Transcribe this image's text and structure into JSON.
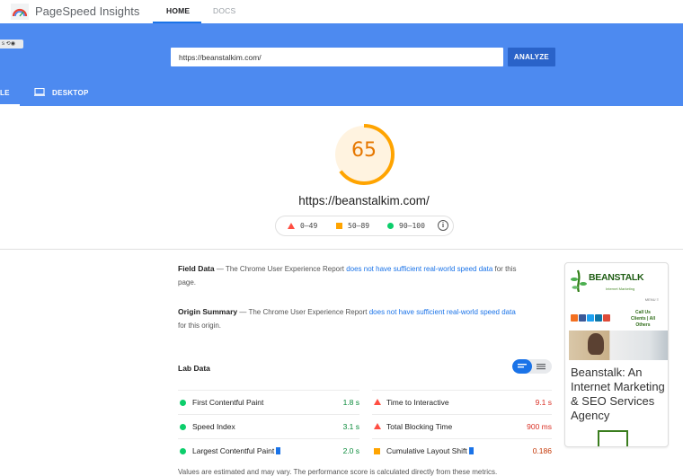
{
  "header": {
    "brand": "PageSpeed Insights",
    "nav": [
      {
        "label": "HOME"
      },
      {
        "label": "DOCS"
      }
    ]
  },
  "hero": {
    "extension_chip": "s",
    "url_value": "https://beanstalkim.com/",
    "analyze_label": "ANALYZE",
    "modes": [
      {
        "label": "LE",
        "active": true
      },
      {
        "label": "DESKTOP",
        "active": false
      }
    ]
  },
  "score": {
    "value": "65",
    "fraction": 0.65,
    "color": "#e67700",
    "url": "https://beanstalkim.com/",
    "legend": [
      {
        "range": "0–49",
        "shape": "triangle",
        "color": "#ff4e42"
      },
      {
        "range": "50–89",
        "shape": "square",
        "color": "#ffa400"
      },
      {
        "range": "90–100",
        "shape": "circle",
        "color": "#0cce6b"
      }
    ],
    "info_icon": "info-icon"
  },
  "field_data": {
    "title": "Field Data",
    "dash": " — The Chrome User Experience Report ",
    "link": "does not have sufficient real-world speed data",
    "tail": " for this page."
  },
  "origin_summary": {
    "title": "Origin Summary",
    "dash": " — The Chrome User Experience Report ",
    "link": "does not have sufficient real-world speed data",
    "tail": " for this origin."
  },
  "lab_data": {
    "title": "Lab Data",
    "metrics_left": [
      {
        "name": "First Contentful Paint",
        "value": "1.8 s",
        "status": "good",
        "flag": false
      },
      {
        "name": "Speed Index",
        "value": "3.1 s",
        "status": "good",
        "flag": false
      },
      {
        "name": "Largest Contentful Paint",
        "value": "2.0 s",
        "status": "good",
        "flag": true
      }
    ],
    "metrics_right": [
      {
        "name": "Time to Interactive",
        "value": "9.1 s",
        "status": "poor",
        "flag": false
      },
      {
        "name": "Total Blocking Time",
        "value": "900 ms",
        "status": "poor",
        "flag": false
      },
      {
        "name": "Cumulative Layout Shift",
        "value": "0.186",
        "status": "average",
        "flag": true
      }
    ],
    "colors": {
      "good": "#0a8a3a",
      "poor": "#d93025",
      "average": "#c33300"
    },
    "bottom_text": "Values are estimated and may vary. The performance score is calculated directly from these metrics."
  },
  "thumbnail": {
    "logo_text": "BEANSTALK",
    "logo_sub": "Internet Marketing",
    "menu": "MENU ≡",
    "call": "Call Us",
    "clients": "Clients | All",
    "others": "Others",
    "title": "Beanstalk: An Internet Marketing & SEO Services Agency"
  }
}
